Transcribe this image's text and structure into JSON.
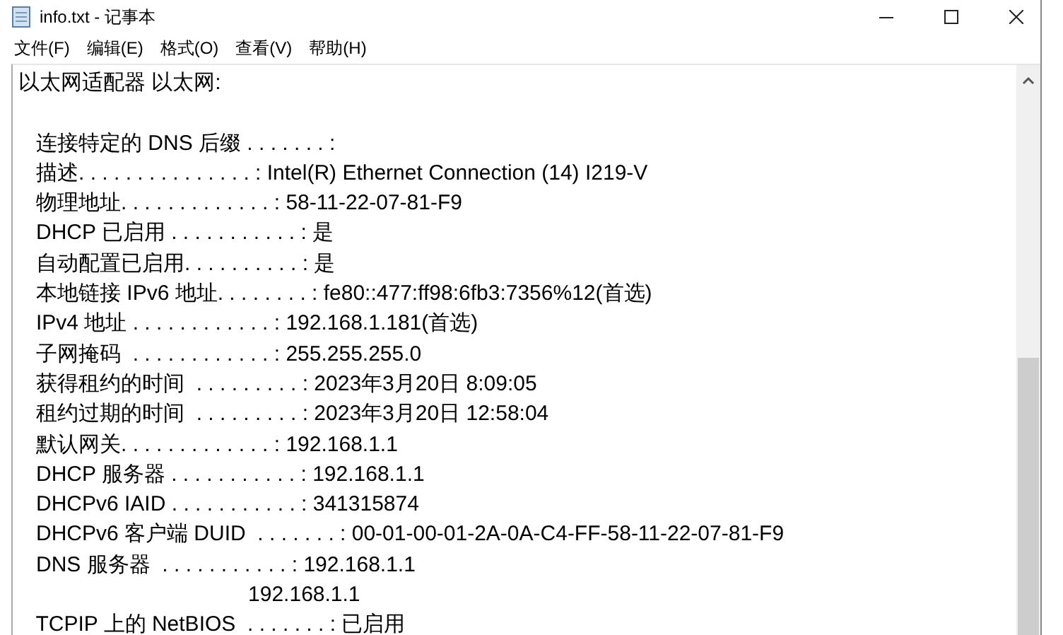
{
  "window": {
    "title": "info.txt - 记事本"
  },
  "menu": [
    "文件(F)",
    "编辑(E)",
    "格式(O)",
    "查看(V)",
    "帮助(H)"
  ],
  "document": {
    "heading": "以太网适配器 以太网:",
    "lines": [
      "   连接特定的 DNS 后缀 . . . . . . . :",
      "   描述. . . . . . . . . . . . . . . : Intel(R) Ethernet Connection (14) I219-V",
      "   物理地址. . . . . . . . . . . . . : 58-11-22-07-81-F9",
      "   DHCP 已启用 . . . . . . . . . . . : 是",
      "   自动配置已启用. . . . . . . . . . : 是",
      "   本地链接 IPv6 地址. . . . . . . . : fe80::477:ff98:6fb3:7356%12(首选)",
      "   IPv4 地址 . . . . . . . . . . . . : 192.168.1.181(首选)",
      "   子网掩码  . . . . . . . . . . . . : 255.255.255.0",
      "   获得租约的时间  . . . . . . . . . : 2023年3月20日 8:09:05",
      "   租约过期的时间  . . . . . . . . . : 2023年3月20日 12:58:04",
      "   默认网关. . . . . . . . . . . . . : 192.168.1.1",
      "   DHCP 服务器 . . . . . . . . . . . : 192.168.1.1",
      "   DHCPv6 IAID . . . . . . . . . . . : 341315874",
      "   DHCPv6 客户端 DUID  . . . . . . . : 00-01-00-01-2A-0A-C4-FF-58-11-22-07-81-F9",
      "   DNS 服务器  . . . . . . . . . . . : 192.168.1.1",
      "                                       192.168.1.1",
      "   TCPIP 上的 NetBIOS  . . . . . . . : 已启用"
    ]
  }
}
